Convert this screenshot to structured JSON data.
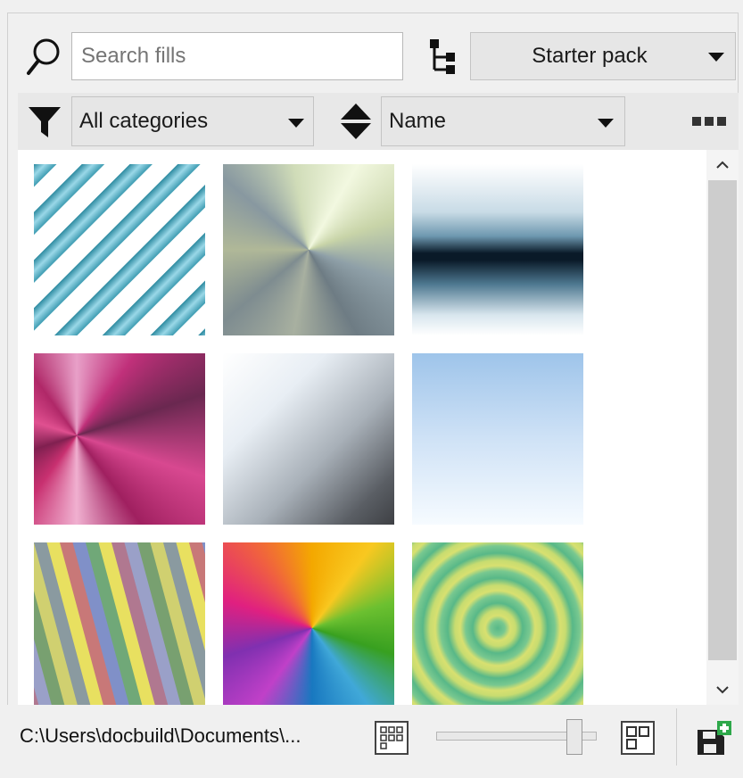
{
  "toolbar": {
    "search_placeholder": "Search fills",
    "search_value": "",
    "pack_selected": "Starter pack",
    "category_selected": "All categories",
    "sort_selected": "Name"
  },
  "icons": {
    "search": "search-icon",
    "tree": "tree-view-icon",
    "filter": "filter-icon",
    "sort": "sort-icon",
    "more": "more-options-icon",
    "scroll_up": "chevron-up-icon",
    "scroll_down": "chevron-down-icon",
    "small_thumbnails": "small-thumbnails-icon",
    "large_thumbnails": "large-thumbnails-icon",
    "save": "save-fill-icon"
  },
  "fills": [
    {
      "kind": "diagonal-stripes-teal",
      "colors": [
        "#ffffff",
        "#5fb4c8"
      ]
    },
    {
      "kind": "conical-silver-green",
      "colors": [
        "#8fa0a8",
        "#c8d4a8"
      ]
    },
    {
      "kind": "horizontal-band-dark-blue",
      "colors": [
        "#e8f0f4",
        "#0a1a28"
      ]
    },
    {
      "kind": "conical-magenta",
      "colors": [
        "#c0307a",
        "#e8a0c8"
      ]
    },
    {
      "kind": "linear-grey-diagonal",
      "colors": [
        "#ffffff",
        "#4a4a4a"
      ]
    },
    {
      "kind": "linear-sky-blue",
      "colors": [
        "#a8c8ec",
        "#f4faff"
      ]
    },
    {
      "kind": "diagonal-stripes-multicolor",
      "colors": [
        "#e8e060",
        "#8090c8"
      ]
    },
    {
      "kind": "conical-rainbow",
      "colors": [
        "#f4a800",
        "#40a8d8"
      ]
    },
    {
      "kind": "concentric-rings-green",
      "colors": [
        "#a8d870",
        "#58b888"
      ]
    }
  ],
  "footer": {
    "path": "C:\\Users\\docbuild\\Documents\\...",
    "thumbnail_size": 0.85
  }
}
